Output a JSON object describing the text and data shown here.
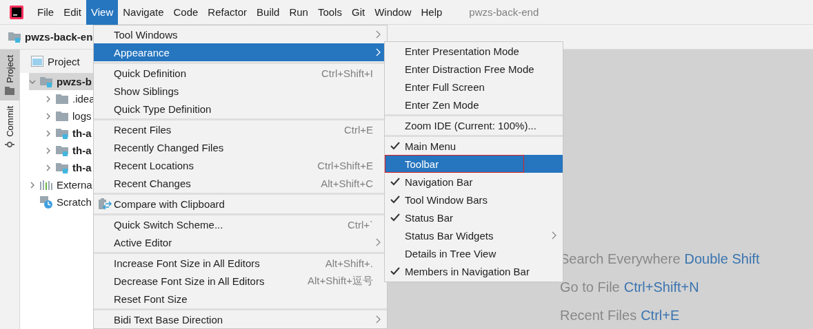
{
  "title_bar": {
    "menus": [
      {
        "label": "File",
        "selected": false
      },
      {
        "label": "Edit",
        "selected": false
      },
      {
        "label": "View",
        "selected": true
      },
      {
        "label": "Navigate",
        "selected": false
      },
      {
        "label": "Code",
        "selected": false
      },
      {
        "label": "Refactor",
        "selected": false
      },
      {
        "label": "Build",
        "selected": false
      },
      {
        "label": "Run",
        "selected": false
      },
      {
        "label": "Tools",
        "selected": false
      },
      {
        "label": "Git",
        "selected": false
      },
      {
        "label": "Window",
        "selected": false
      },
      {
        "label": "Help",
        "selected": false
      }
    ],
    "project_title": "pwzs-back-end"
  },
  "navigation_bar": {
    "project": "pwzs-back-en"
  },
  "tool_window_strip": [
    {
      "label": "Project",
      "kind": "project",
      "selected": true
    },
    {
      "label": "Commit",
      "kind": "commit",
      "selected": false
    }
  ],
  "project_panel": {
    "header": "Project",
    "tree": [
      {
        "label": "pwzs-b",
        "kind": "module",
        "expanded": true,
        "selected": true,
        "children": [
          {
            "label": ".idea",
            "kind": "folder",
            "expanded": false,
            "selected": false
          },
          {
            "label": "logs",
            "kind": "folder",
            "expanded": false,
            "selected": false
          },
          {
            "label": "th-a",
            "kind": "module",
            "expanded": false,
            "selected": false
          },
          {
            "label": "th-a",
            "kind": "module",
            "expanded": false,
            "selected": false
          },
          {
            "label": "th-a",
            "kind": "module",
            "expanded": false,
            "selected": false
          }
        ]
      },
      {
        "label": "Externa",
        "kind": "libraries",
        "expanded": false,
        "selected": false
      },
      {
        "label": "Scratch",
        "kind": "scratch",
        "selected": false
      }
    ]
  },
  "view_menu": {
    "groups": [
      [
        {
          "label": "Tool Windows",
          "kind": "action",
          "submenu": true,
          "selected": false
        },
        {
          "label": "Appearance",
          "kind": "action",
          "submenu": true,
          "selected": true
        }
      ],
      [
        {
          "label": "Quick Definition",
          "kind": "action",
          "shortcut": "Ctrl+Shift+I",
          "submenu": false,
          "selected": false
        },
        {
          "label": "Show Siblings",
          "kind": "action",
          "submenu": false,
          "selected": false
        },
        {
          "label": "Quick Type Definition",
          "kind": "action",
          "submenu": false,
          "selected": false
        }
      ],
      [
        {
          "label": "Recent Files",
          "kind": "action",
          "shortcut": "Ctrl+E",
          "submenu": false,
          "selected": false
        },
        {
          "label": "Recently Changed Files",
          "kind": "action",
          "submenu": false,
          "selected": false
        },
        {
          "label": "Recent Locations",
          "kind": "action",
          "shortcut": "Ctrl+Shift+E",
          "submenu": false,
          "selected": false
        },
        {
          "label": "Recent Changes",
          "kind": "action",
          "shortcut": "Alt+Shift+C",
          "submenu": false,
          "selected": false
        }
      ],
      [
        {
          "label": "Compare with Clipboard",
          "kind": "compare",
          "submenu": false,
          "selected": false
        }
      ],
      [
        {
          "label": "Quick Switch Scheme...",
          "kind": "action",
          "shortcut": "Ctrl+`",
          "submenu": false,
          "selected": false
        },
        {
          "label": "Active Editor",
          "kind": "action",
          "submenu": true,
          "selected": false
        }
      ],
      [
        {
          "label": "Increase Font Size in All Editors",
          "kind": "action",
          "shortcut": "Alt+Shift+.",
          "submenu": false,
          "selected": false
        },
        {
          "label": "Decrease Font Size in All Editors",
          "kind": "action",
          "shortcut": "Alt+Shift+逗号",
          "submenu": false,
          "selected": false
        },
        {
          "label": "Reset Font Size",
          "kind": "action",
          "submenu": false,
          "selected": false
        }
      ],
      [
        {
          "label": "Bidi Text Base Direction",
          "kind": "action",
          "submenu": true,
          "selected": false
        }
      ]
    ]
  },
  "appearance_submenu": {
    "groups": [
      [
        {
          "label": "Enter Presentation Mode",
          "checked": false,
          "submenu": false,
          "selected": false,
          "highlighted": false
        },
        {
          "label": "Enter Distraction Free Mode",
          "checked": false,
          "submenu": false,
          "selected": false,
          "highlighted": false
        },
        {
          "label": "Enter Full Screen",
          "checked": false,
          "submenu": false,
          "selected": false,
          "highlighted": false
        },
        {
          "label": "Enter Zen Mode",
          "checked": false,
          "submenu": false,
          "selected": false,
          "highlighted": false
        }
      ],
      [
        {
          "label": "Zoom IDE (Current: 100%)...",
          "checked": false,
          "submenu": false,
          "selected": false,
          "highlighted": false
        }
      ],
      [
        {
          "label": "Main Menu",
          "checked": true,
          "submenu": false,
          "selected": false,
          "highlighted": false
        },
        {
          "label": "Toolbar",
          "checked": false,
          "submenu": false,
          "selected": true,
          "highlighted": true
        },
        {
          "label": "Navigation Bar",
          "checked": true,
          "submenu": false,
          "selected": false,
          "highlighted": false
        },
        {
          "label": "Tool Window Bars",
          "checked": true,
          "submenu": false,
          "selected": false,
          "highlighted": false
        },
        {
          "label": "Status Bar",
          "checked": true,
          "submenu": false,
          "selected": false,
          "highlighted": false
        },
        {
          "label": "Status Bar Widgets",
          "checked": false,
          "submenu": true,
          "selected": false,
          "highlighted": false
        },
        {
          "label": "Details in Tree View",
          "checked": false,
          "submenu": false,
          "selected": false,
          "highlighted": false
        },
        {
          "label": "Members in Navigation Bar",
          "checked": true,
          "submenu": false,
          "selected": false,
          "highlighted": false
        }
      ]
    ]
  },
  "editor_hints": [
    {
      "action": "Search Everywhere",
      "shortcut": "Double Shift"
    },
    {
      "action": "Go to File",
      "shortcut": "Ctrl+Shift+N"
    },
    {
      "action": "Recent Files",
      "shortcut": "Ctrl+E"
    }
  ]
}
